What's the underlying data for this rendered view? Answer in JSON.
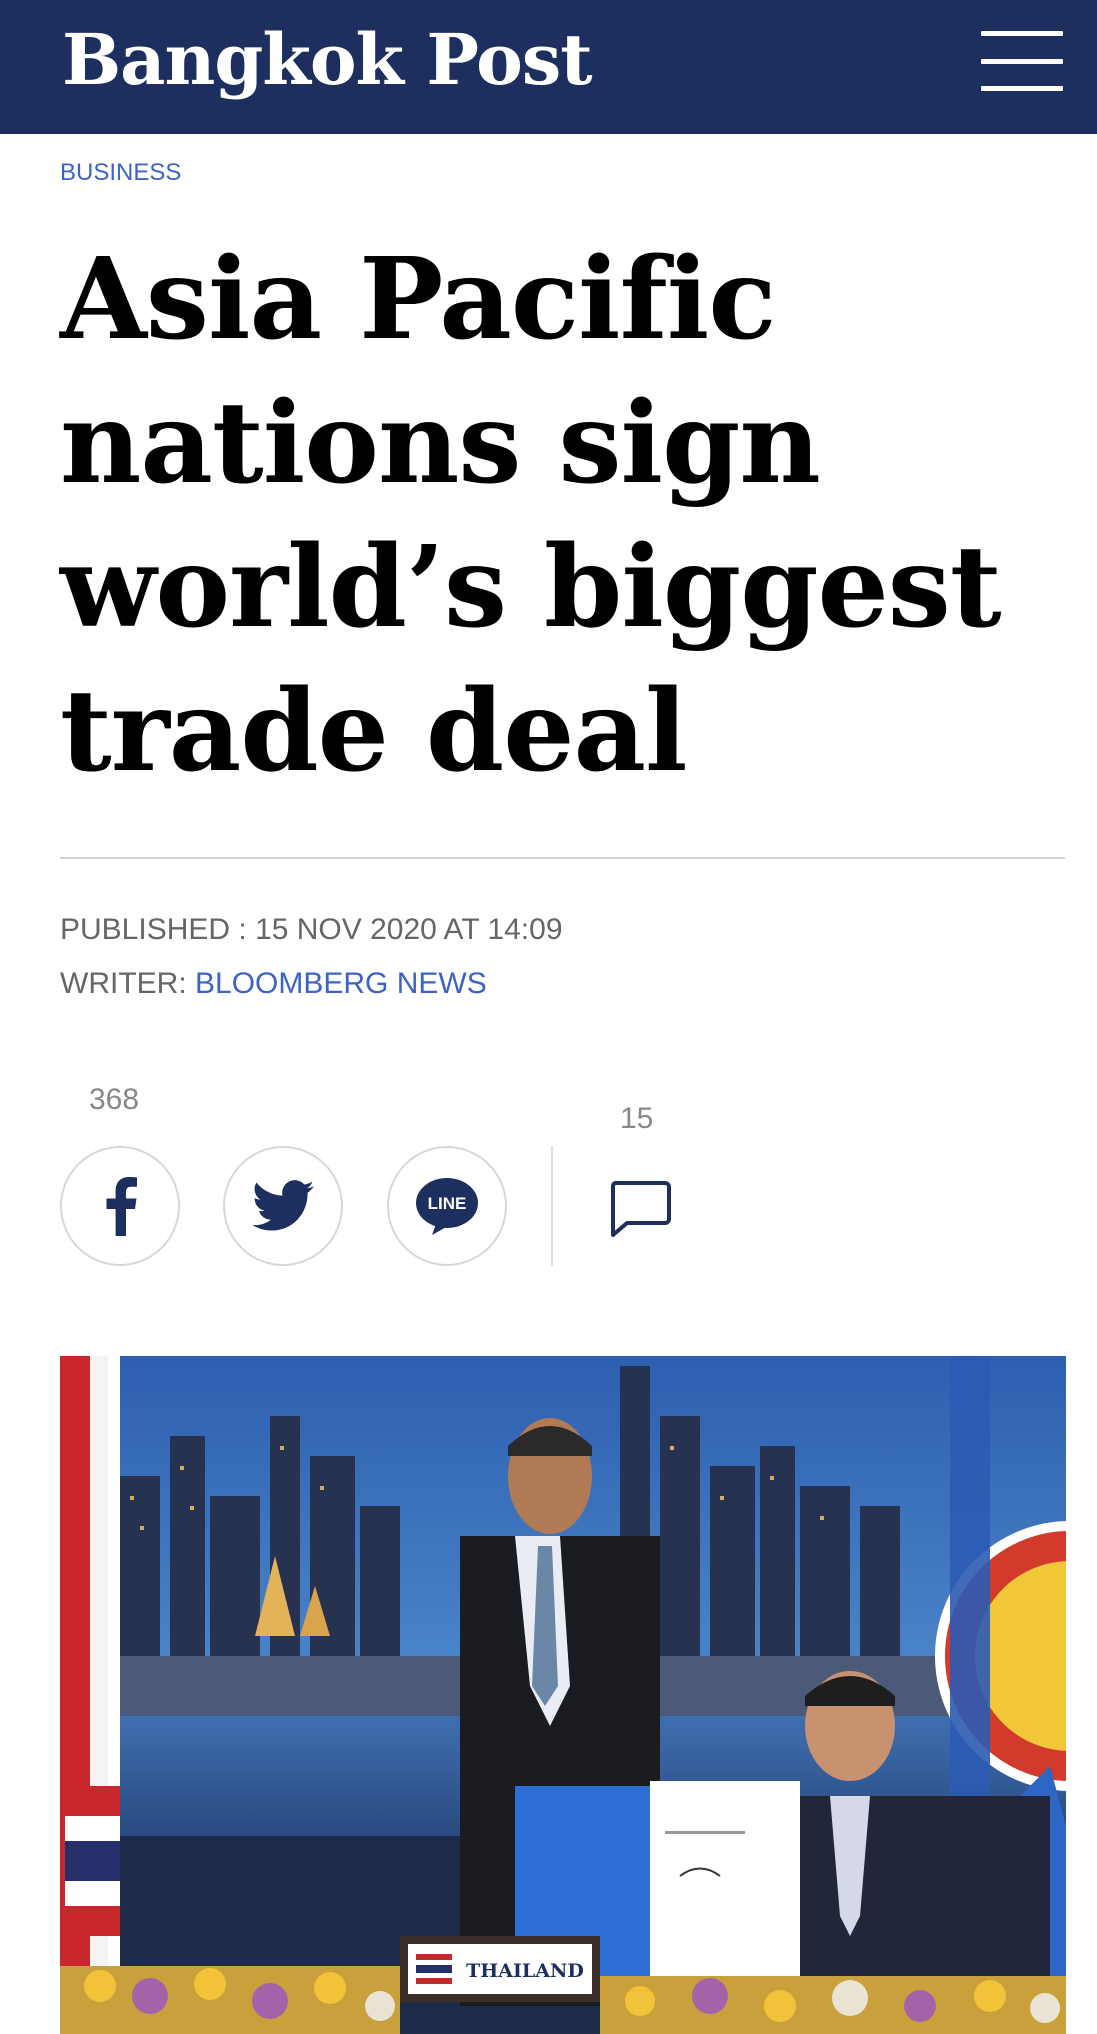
{
  "header": {
    "logo_text": "Bangkok Post",
    "bg_color": "#1c2f5e"
  },
  "article": {
    "section": "BUSINESS",
    "headline": "Asia Pacific nations sign world’s biggest trade deal",
    "published_label": "PUBLISHED : ",
    "published_value": "15 NOV 2020 AT 14:09",
    "writer_label": "WRITER: ",
    "writer_name": "BLOOMBERG NEWS"
  },
  "share": {
    "share_count": "368",
    "comment_count": "15",
    "buttons": [
      {
        "name": "facebook",
        "icon": "facebook-icon"
      },
      {
        "name": "twitter",
        "icon": "twitter-icon"
      },
      {
        "name": "line",
        "icon": "line-icon",
        "label": "LINE"
      }
    ]
  },
  "photo": {
    "nameplate_text": "THAILAND"
  },
  "colors": {
    "link": "#3d63c8",
    "meta": "#666666"
  }
}
